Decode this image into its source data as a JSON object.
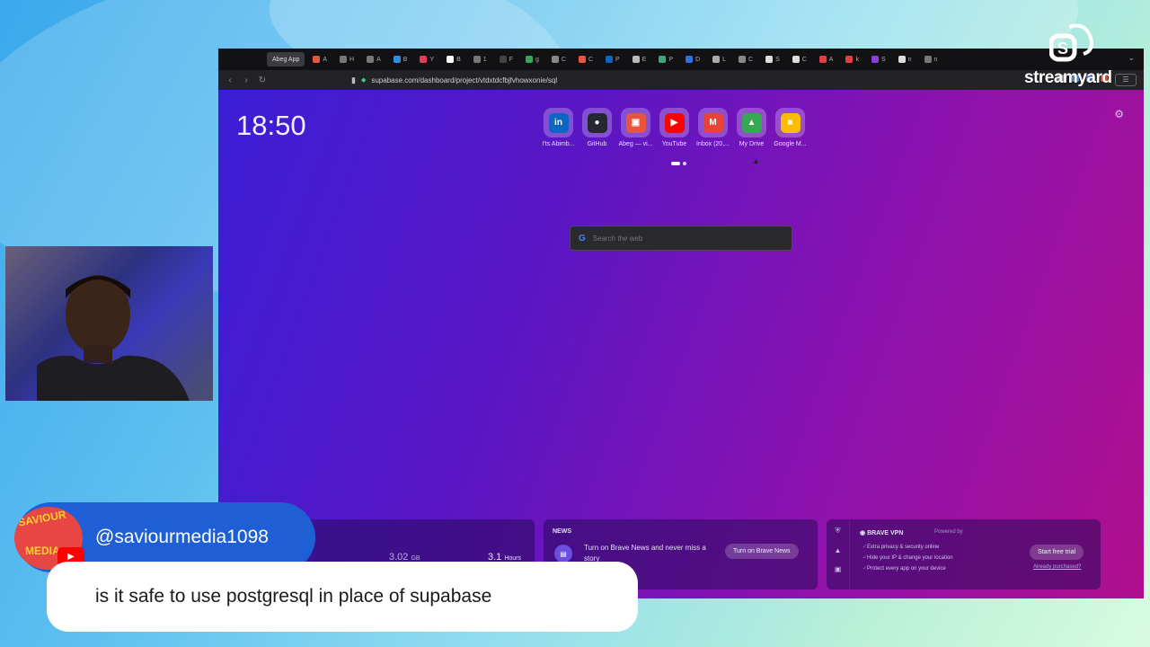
{
  "browser": {
    "active_tab": "Abeg App",
    "tabs": [
      {
        "letter": "A",
        "color": "#e8553d"
      },
      {
        "letter": "H",
        "color": "#777"
      },
      {
        "letter": "A",
        "color": "#777"
      },
      {
        "letter": "B",
        "color": "#2f8ee0"
      },
      {
        "letter": "Y",
        "color": "#e03b58"
      },
      {
        "letter": "B",
        "color": "#ffffff"
      },
      {
        "letter": "1",
        "color": "#777"
      },
      {
        "letter": "F",
        "color": "#444"
      },
      {
        "letter": "g",
        "color": "#34a853"
      },
      {
        "letter": "C",
        "color": "#888"
      },
      {
        "letter": "C",
        "color": "#e8553d"
      },
      {
        "letter": "P",
        "color": "#0a66c2"
      },
      {
        "letter": "E",
        "color": "#bbb"
      },
      {
        "letter": "P",
        "color": "#3aa87a"
      },
      {
        "letter": "D",
        "color": "#2f6fe0"
      },
      {
        "letter": "L",
        "color": "#aaa"
      },
      {
        "letter": "C",
        "color": "#888"
      },
      {
        "letter": "S",
        "color": "#ddd"
      },
      {
        "letter": "C",
        "color": "#ddd"
      },
      {
        "letter": "A",
        "color": "#e04040"
      },
      {
        "letter": "k",
        "color": "#e04040"
      },
      {
        "letter": "S",
        "color": "#8a3ee0"
      },
      {
        "letter": "n",
        "color": "#ddd"
      },
      {
        "letter": "n",
        "color": "#777"
      }
    ],
    "url": "supabase.com/dashboard/project/vtdxtdcfbjfvhowxonie/sql"
  },
  "newtab": {
    "clock": "18:50",
    "shortcuts": [
      {
        "label": "I'ts Abimb...",
        "icon": "linkedin-icon",
        "glyph": "in",
        "color": "#0a66c2"
      },
      {
        "label": "GitHub",
        "icon": "github-icon",
        "glyph": "●",
        "color": "#24292e"
      },
      {
        "label": "Abeg — vi...",
        "icon": "abeg-icon",
        "glyph": "▣",
        "color": "#e8553d"
      },
      {
        "label": "YouTube",
        "icon": "youtube-icon",
        "glyph": "▶",
        "color": "#ff0000"
      },
      {
        "label": "Inbox (20,...",
        "icon": "gmail-icon",
        "glyph": "M",
        "color": "#ea4335"
      },
      {
        "label": "My Drive",
        "icon": "drive-icon",
        "glyph": "▲",
        "color": "#34a853"
      },
      {
        "label": "Google M...",
        "icon": "google-meet-icon",
        "glyph": "■",
        "color": "#fbbc04"
      }
    ],
    "search_placeholder": "Search the web",
    "stats": {
      "data_value": "3.02",
      "data_unit": "GB",
      "time_value": "3.1",
      "time_unit": "Hours"
    },
    "news": {
      "heading": "NEWS",
      "text": "Turn on Brave News and never miss a story",
      "button": "Turn on Brave News"
    },
    "vpn": {
      "title": "BRAVE VPN",
      "powered": "Powered by",
      "features": [
        "Extra privacy & security online",
        "Hide your IP & change your location",
        "Protect every app on your device"
      ],
      "button": "Start free trial",
      "link": "Already purchased?"
    }
  },
  "overlay": {
    "brand": "streamyard",
    "handle": "@saviourmedia1098",
    "comment": "is it safe to use postgresql in place of supabase"
  }
}
